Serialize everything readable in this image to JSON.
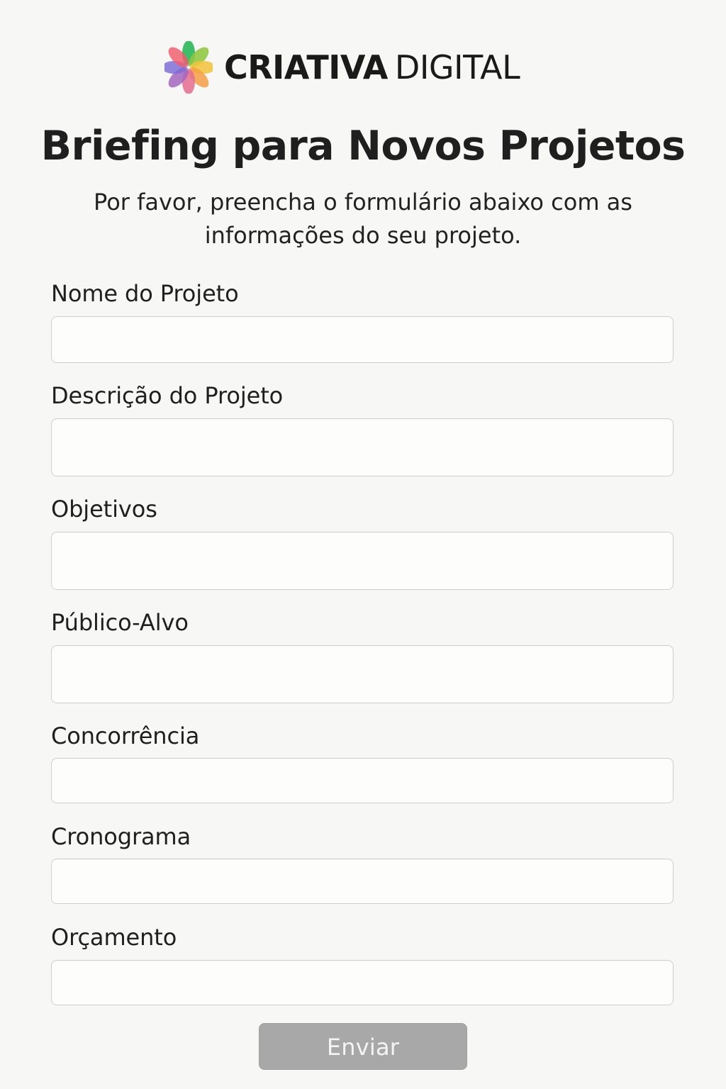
{
  "brand": {
    "name_strong": "CRIATIVA",
    "name_light": "DIGITAL",
    "logo_icon": "colorful-flower-logo-icon"
  },
  "header": {
    "title": "Briefing para Novos Projetos",
    "subtitle": "Por favor, preencha o formulário abaixo com as informações do seu projeto."
  },
  "form": {
    "fields": [
      {
        "label": "Nome do Projeto",
        "value": ""
      },
      {
        "label": "Descrição do Projeto",
        "value": ""
      },
      {
        "label": "Objetivos",
        "value": ""
      },
      {
        "label": "Público-Alvo",
        "value": ""
      },
      {
        "label": "Concorrência",
        "value": ""
      },
      {
        "label": "Cronograma",
        "value": ""
      },
      {
        "label": "Orçamento",
        "value": ""
      }
    ],
    "submit_label": "Enviar"
  },
  "colors": {
    "background": "#f7f7f6",
    "input_border": "#cfcfcc",
    "button_background": "#a8a8a8",
    "button_text": "#f4f4f4"
  }
}
